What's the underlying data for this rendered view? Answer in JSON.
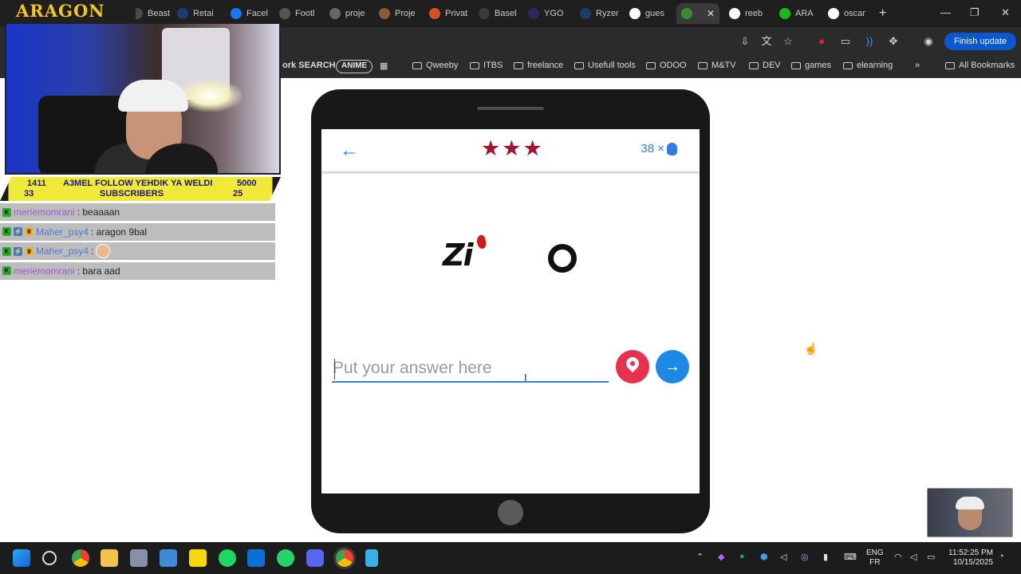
{
  "browser": {
    "tabs": [
      {
        "label": "Beast",
        "color": "#4a4a4a"
      },
      {
        "label": "Retai",
        "color": "#1e3a6e"
      },
      {
        "label": "Facel",
        "color": "#1877f2"
      },
      {
        "label": "Footl",
        "color": "#555555"
      },
      {
        "label": "proje",
        "color": "#666666"
      },
      {
        "label": "Proje",
        "color": "#8a5a3a"
      },
      {
        "label": "Privat",
        "color": "#d0502a"
      },
      {
        "label": "Basel",
        "color": "#3a3a3a"
      },
      {
        "label": "YGO",
        "color": "#2a2a5a"
      },
      {
        "label": "Ryzer",
        "color": "#1e3a6e"
      },
      {
        "label": "gues",
        "color": "#ffffff"
      },
      {
        "label": "",
        "color": "#3a8a3a",
        "active": true
      },
      {
        "label": "reeb",
        "color": "#ffffff"
      },
      {
        "label": "ARA",
        "color": "#18b918"
      },
      {
        "label": "oscar",
        "color": "#ffffff"
      }
    ],
    "finish_update": "Finish update",
    "bookmarks": {
      "work_search": "ork SEARCH",
      "anime": "ANIME",
      "items": [
        "Qweeby",
        "ITBS",
        "freelance",
        "Usefull tools",
        "ODOO",
        "M&TV",
        "DEV",
        "games",
        "elearning"
      ],
      "overflow": "»",
      "all_bookmarks": "All Bookmarks"
    }
  },
  "overlay": {
    "brand": "ARAGON",
    "stats": {
      "follow_count": "1411",
      "follow_text": "A3MEL FOLLOW YEHDIK YA WELDI",
      "follow_goal": "5000",
      "sub_count": "33",
      "sub_text": "SUBSCRIBERS",
      "sub_goal": "25"
    },
    "chat": [
      {
        "user": "meriemomrani",
        "message": ": beaaaan",
        "badges": [
          "k"
        ]
      },
      {
        "user": "Maher_psy4",
        "message": ": aragon 9bal",
        "badges": [
          "k",
          "b",
          "c"
        ]
      },
      {
        "user": "Maher_psy4",
        "message": ":",
        "badges": [
          "k",
          "b",
          "c"
        ],
        "emote": true
      },
      {
        "user": "meriemomrani",
        "message": ": bara aad",
        "badges": [
          "k"
        ]
      }
    ]
  },
  "game": {
    "back": "←",
    "stars": [
      "★",
      "★",
      "★"
    ],
    "hints_count": "38 ×",
    "logo_letters": "Zi",
    "answer_placeholder": "Put your answer here",
    "submit_icon": "→",
    "colors": {
      "accent": "#1e88e5",
      "star": "#a5122e",
      "hint_button": "#e8304f"
    }
  },
  "taskbar": {
    "lang_top": "ENG",
    "lang_bottom": "FR",
    "time": "11:52:25 PM",
    "date": "10/15/2025"
  }
}
